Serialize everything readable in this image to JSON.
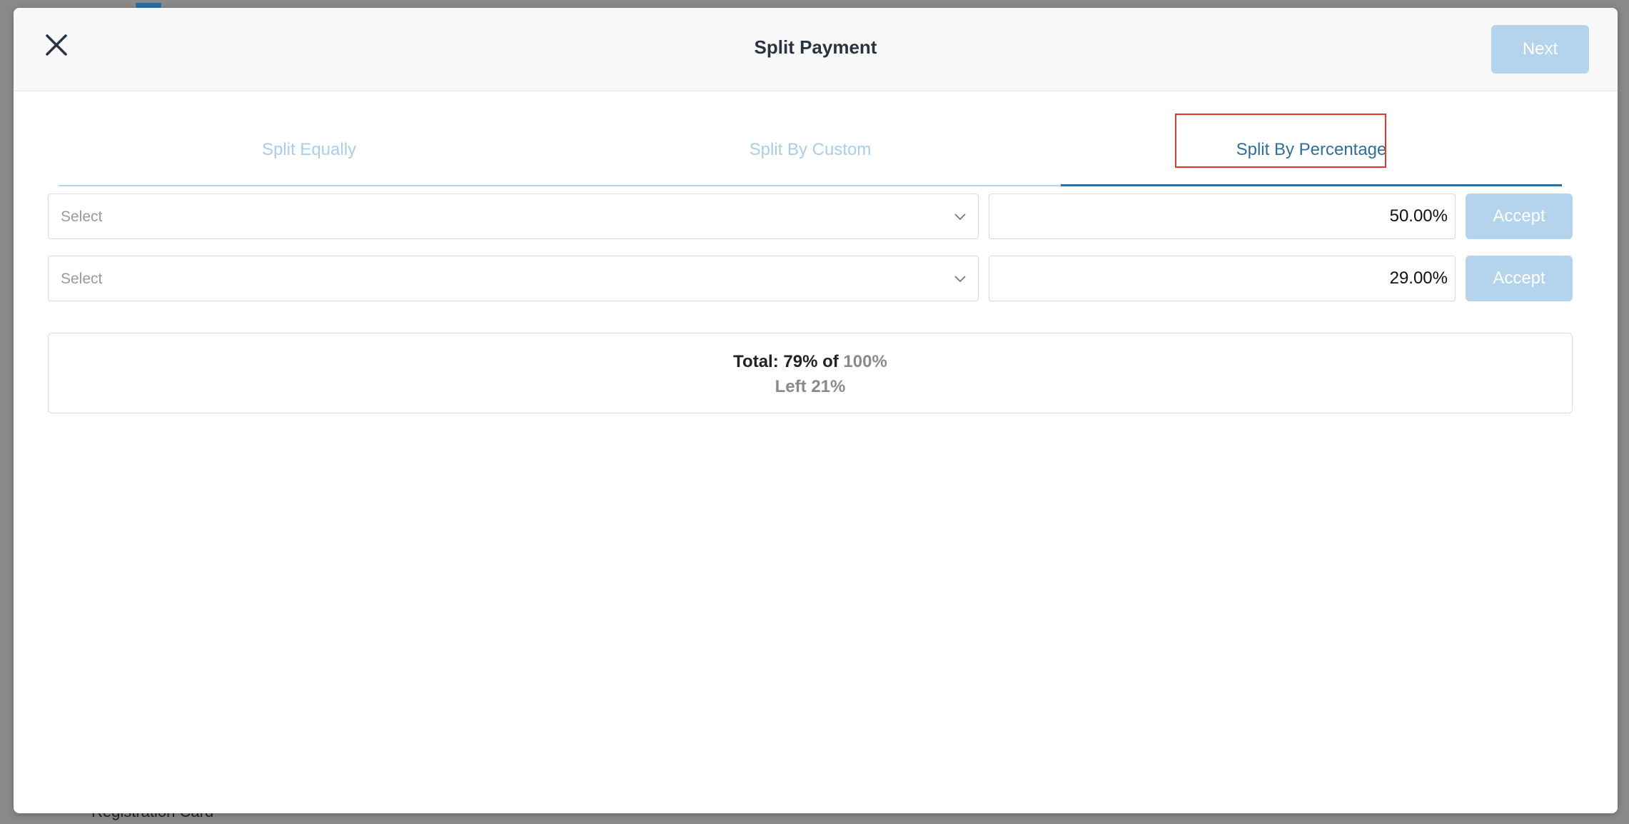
{
  "background": {
    "fragment_text": "Registration Card"
  },
  "modal": {
    "title": "Split Payment",
    "next_label": "Next"
  },
  "tabs": [
    {
      "label": "Split Equally",
      "active": false
    },
    {
      "label": "Split By Custom",
      "active": false
    },
    {
      "label": "Split By Percentage",
      "active": true
    }
  ],
  "rows": [
    {
      "select_placeholder": "Select",
      "percentage": "50.00%",
      "accept_label": "Accept"
    },
    {
      "select_placeholder": "Select",
      "percentage": "29.00%",
      "accept_label": "Accept"
    }
  ],
  "summary": {
    "total_label": "Total:",
    "total_value": "79% of",
    "total_max": "100%",
    "left_label": "Left",
    "left_value": "21%"
  },
  "colors": {
    "accent": "#2f6e9e",
    "accent_light": "#b3d4ec",
    "highlight_border": "#e0382c"
  },
  "icons": {
    "close": "close-icon",
    "chevron": "chevron-down-icon"
  }
}
